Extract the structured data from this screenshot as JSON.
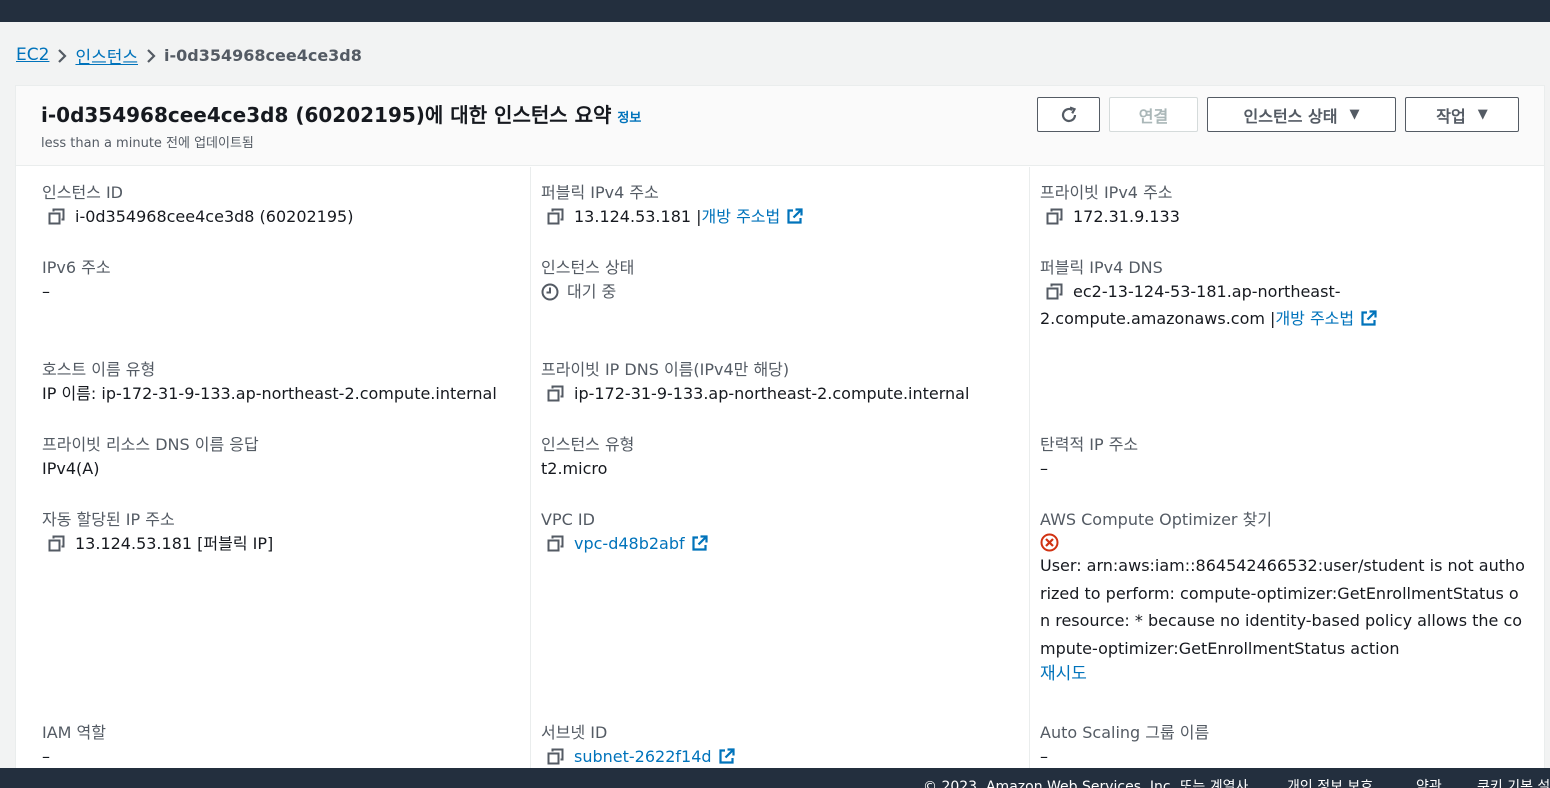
{
  "breadcrumb": {
    "items": [
      "EC2",
      "인스턴스"
    ],
    "current": "i-0d354968cee4ce3d8"
  },
  "header": {
    "title": "i-0d354968cee4ce3d8 (60202195)에 대한 인스턴스 요약",
    "info_link": "정보",
    "subtitle": "less than a minute 전에 업데이트됨",
    "buttons": {
      "connect": "연결",
      "instance_state": "인스턴스 상태",
      "actions": "작업"
    }
  },
  "details": {
    "instance_id": {
      "label": "인스턴스 ID",
      "value": "i-0d354968cee4ce3d8 (60202195)"
    },
    "public_ipv4": {
      "label": "퍼블릭 IPv4 주소",
      "value": "13.124.53.181",
      "separator": "|",
      "link": "개방 주소법"
    },
    "private_ipv4": {
      "label": "프라이빗 IPv4 주소",
      "value": "172.31.9.133"
    },
    "ipv6": {
      "label": "IPv6 주소",
      "value": "–"
    },
    "instance_state": {
      "label": "인스턴스 상태",
      "value": "대기 중"
    },
    "public_dns": {
      "label": "퍼블릭 IPv4 DNS",
      "value_line1": "ec2-13-124-53-181.ap-northeast-",
      "value_line2": "2.compute.amazonaws.com",
      "separator": "|",
      "link": "개방 주소법"
    },
    "hostname_type": {
      "label": "호스트 이름 유형",
      "value": "IP 이름: ip-172-31-9-133.ap-northeast-2.compute.internal"
    },
    "private_dns": {
      "label": "프라이빗 IP DNS 이름(IPv4만 해당)",
      "value": "ip-172-31-9-133.ap-northeast-2.compute.internal"
    },
    "resource_dns": {
      "label": "프라이빗 리소스 DNS 이름 응답",
      "value": "IPv4(A)"
    },
    "instance_type": {
      "label": "인스턴스 유형",
      "value": "t2.micro"
    },
    "elastic_ip": {
      "label": "탄력적 IP 주소",
      "value": "–"
    },
    "auto_ip": {
      "label": "자동 할당된 IP 주소",
      "value": "13.124.53.181 [퍼블릭 IP]"
    },
    "vpc_id": {
      "label": "VPC ID",
      "value": "vpc-d48b2abf"
    },
    "optimizer": {
      "label": "AWS Compute Optimizer 찾기",
      "error_lines": [
        "User: arn:aws:iam::864542466532:user/student is not autho",
        "rized to perform: compute-optimizer:GetEnrollmentStatus o",
        "n resource: * because no identity-based policy allows the co",
        "mpute-optimizer:GetEnrollmentStatus action"
      ],
      "retry": "재시도"
    },
    "iam_role": {
      "label": "IAM 역할",
      "value": "–"
    },
    "subnet_id": {
      "label": "서브넷 ID",
      "value": "subnet-2622f14d"
    },
    "asg_name": {
      "label": "Auto Scaling 그룹 이름",
      "value": "–"
    }
  },
  "footer": {
    "copyright": "© 2023, Amazon Web Services, Inc. 또는 계열사.",
    "privacy": "개인 정보 보호",
    "terms": "약관",
    "cookies": "쿠키 기본 설정"
  },
  "colors": {
    "topbar": "#232f3e",
    "link": "#0073bb",
    "error": "#d13212"
  }
}
